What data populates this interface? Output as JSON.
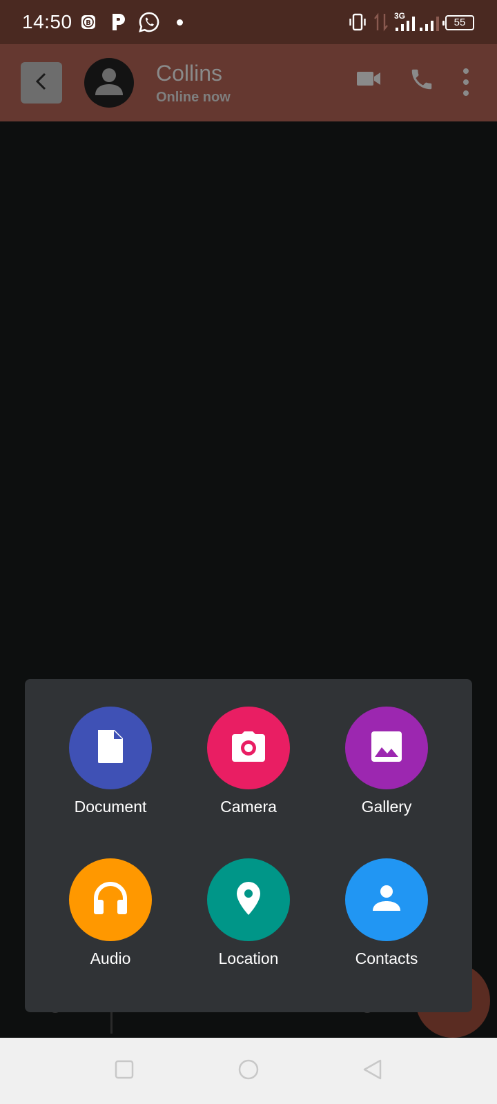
{
  "status_bar": {
    "time": "14:50",
    "network": "3G",
    "battery": "55",
    "icons": [
      "bitcoin-icon",
      "p-icon",
      "whatsapp-icon",
      "dot-icon",
      "vibrate-icon",
      "data-arrows-icon",
      "signal-icon",
      "signal-icon-2",
      "battery-icon"
    ]
  },
  "header": {
    "contact_name": "Collins",
    "contact_status": "Online now",
    "icons": [
      "back-icon",
      "avatar-icon",
      "video-call-icon",
      "phone-icon",
      "more-icon"
    ]
  },
  "attachments": {
    "items": [
      {
        "label": "Document",
        "icon": "document-icon",
        "color": "#3f51b5"
      },
      {
        "label": "Camera",
        "icon": "camera-icon",
        "color": "#e91e63"
      },
      {
        "label": "Gallery",
        "icon": "gallery-icon",
        "color": "#9c27b0"
      },
      {
        "label": "Audio",
        "icon": "headphones-icon",
        "color": "#ff9800"
      },
      {
        "label": "Location",
        "icon": "location-pin-icon",
        "color": "#009688"
      },
      {
        "label": "Contacts",
        "icon": "contact-icon",
        "color": "#2196f3"
      }
    ]
  },
  "nav_bar": {
    "icons": [
      "recents-icon",
      "home-icon",
      "back-nav-icon"
    ]
  },
  "colors": {
    "status_bar": "#4a2921",
    "header": "#653830",
    "sheet": "#303336",
    "background": "#0d0f0f"
  }
}
